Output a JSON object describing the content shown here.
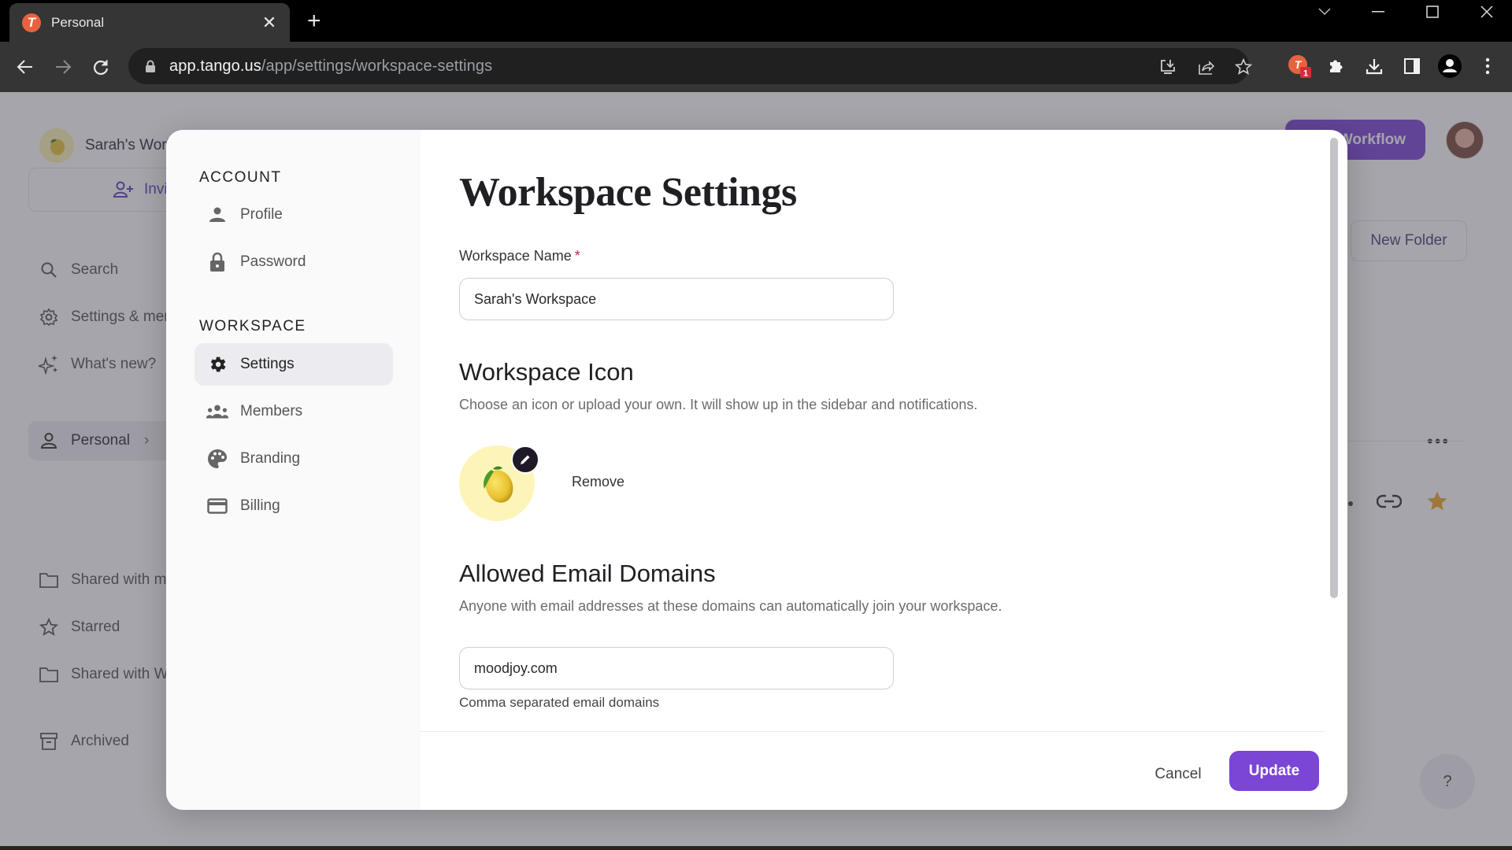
{
  "browser": {
    "tab_title": "Personal",
    "tab_favicon_letter": "T",
    "url_host": "app.tango.us",
    "url_path": "/app/settings/workspace-settings",
    "extension_badge": "1"
  },
  "app": {
    "workspace_name": "Sarah's Workspace",
    "invite_label": "Invite",
    "sidebar": [
      {
        "icon": "search-icon",
        "label": "Search"
      },
      {
        "icon": "gear-icon",
        "label": "Settings & members"
      },
      {
        "icon": "sparkle-icon",
        "label": "What's new?"
      },
      {
        "icon": "person-icon",
        "label": "Personal"
      },
      {
        "icon": "folder-icon",
        "label": "Shared with me"
      },
      {
        "icon": "star-icon",
        "label": "Starred"
      },
      {
        "icon": "folder-icon",
        "label": "Shared with Workspace"
      },
      {
        "icon": "archive-icon",
        "label": "Archived"
      }
    ],
    "new_workflow_label": "New Workflow",
    "new_folder_label": "New Folder",
    "help_label": "?"
  },
  "modal": {
    "nav": {
      "account_heading": "ACCOUNT",
      "account_items": [
        {
          "icon": "person-icon",
          "label": "Profile"
        },
        {
          "icon": "lock-icon",
          "label": "Password"
        }
      ],
      "workspace_heading": "WORKSPACE",
      "workspace_items": [
        {
          "icon": "gear-icon",
          "label": "Settings",
          "active": true
        },
        {
          "icon": "group-icon",
          "label": "Members"
        },
        {
          "icon": "palette-icon",
          "label": "Branding"
        },
        {
          "icon": "credit-card-icon",
          "label": "Billing"
        }
      ]
    },
    "title": "Workspace Settings",
    "name_field": {
      "label": "Workspace Name",
      "required_mark": "*",
      "value": "Sarah's Workspace"
    },
    "icon_section": {
      "title": "Workspace Icon",
      "description": "Choose an icon or upload your own. It will show up in the sidebar and notifications.",
      "icon": "lemon",
      "remove_label": "Remove"
    },
    "domains_section": {
      "title": "Allowed Email Domains",
      "description": "Anyone with email addresses at these domains can automatically join your workspace.",
      "value": "moodjoy.com",
      "helper": "Comma separated email domains"
    },
    "cancel_label": "Cancel",
    "update_label": "Update"
  },
  "colors": {
    "accent": "#7b45d6",
    "required": "#c0285a"
  }
}
